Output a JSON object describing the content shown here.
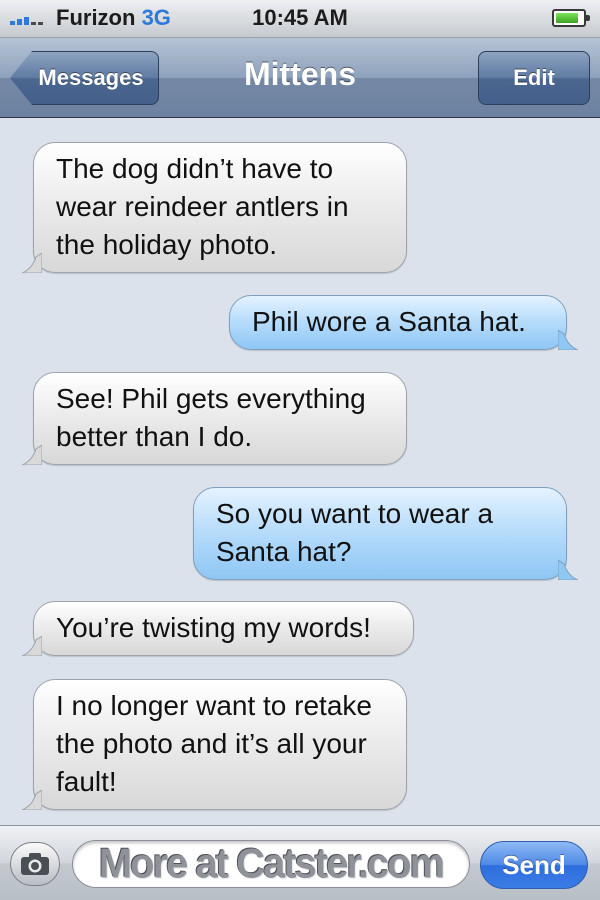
{
  "status_bar": {
    "carrier": "Furizon",
    "network": "3G",
    "time": "10:45 AM",
    "signal_bars": 3,
    "signal_max": 5,
    "battery_level": 0.85,
    "signal_color": "#2f7ad8",
    "battery_color": "#3aa21f"
  },
  "nav": {
    "back_label": "Messages",
    "title": "Mittens",
    "edit_label": "Edit"
  },
  "messages": [
    {
      "direction": "received",
      "text": "The dog didn’t have to wear reindeer antlers in the holiday photo.",
      "lines": [
        "The dog didn’t have to",
        "wear reindeer antlers in",
        "the holiday photo."
      ]
    },
    {
      "direction": "sent",
      "text": "Phil wore a Santa hat.",
      "lines": [
        "Phil wore a Santa hat."
      ]
    },
    {
      "direction": "received",
      "text": "See! Phil gets everything better than I do.",
      "lines": [
        "See! Phil gets everything",
        "better than I do."
      ]
    },
    {
      "direction": "sent",
      "text": "So you want to wear a Santa hat?",
      "lines": [
        "So you want to wear a",
        "Santa hat?"
      ]
    },
    {
      "direction": "received",
      "text": "You’re twisting my words!",
      "lines": [
        "You’re twisting my words!"
      ]
    },
    {
      "direction": "received",
      "text": "I no longer want to retake the photo and it’s all your fault!",
      "lines": [
        "I no longer want to retake",
        "the photo and it’s all your",
        "fault!"
      ]
    }
  ],
  "input": {
    "camera_icon": "camera-icon",
    "field_text": "More at Catster.com",
    "send_label": "Send"
  },
  "colors": {
    "received_bubble": "#e6e6e6",
    "sent_bubble": "#a9d4f7",
    "background": "#dbe2ec",
    "send_button": "#3b7de6"
  }
}
